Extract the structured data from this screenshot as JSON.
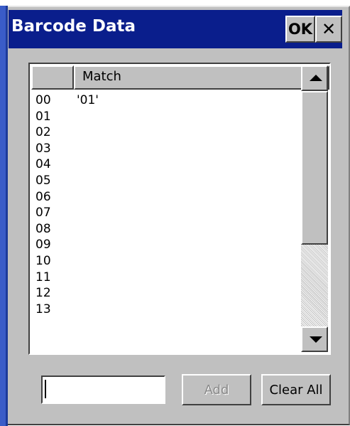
{
  "window": {
    "title": "Barcode Data",
    "ok_label": "OK",
    "close_glyph": "✕"
  },
  "list": {
    "columns": [
      "",
      "Match"
    ],
    "rows": [
      {
        "index": "00",
        "match": "'01'"
      },
      {
        "index": "01",
        "match": ""
      },
      {
        "index": "02",
        "match": ""
      },
      {
        "index": "03",
        "match": ""
      },
      {
        "index": "04",
        "match": ""
      },
      {
        "index": "05",
        "match": ""
      },
      {
        "index": "06",
        "match": ""
      },
      {
        "index": "07",
        "match": ""
      },
      {
        "index": "08",
        "match": ""
      },
      {
        "index": "09",
        "match": ""
      },
      {
        "index": "10",
        "match": ""
      },
      {
        "index": "11",
        "match": ""
      },
      {
        "index": "12",
        "match": ""
      },
      {
        "index": "13",
        "match": ""
      }
    ]
  },
  "input": {
    "value": "",
    "placeholder": ""
  },
  "buttons": {
    "add_label": "Add",
    "clear_all_label": "Clear All"
  },
  "colors": {
    "titlebar": "#0a1e8c",
    "face": "#c0c0c0",
    "disabled_text": "#8a8a8a"
  }
}
